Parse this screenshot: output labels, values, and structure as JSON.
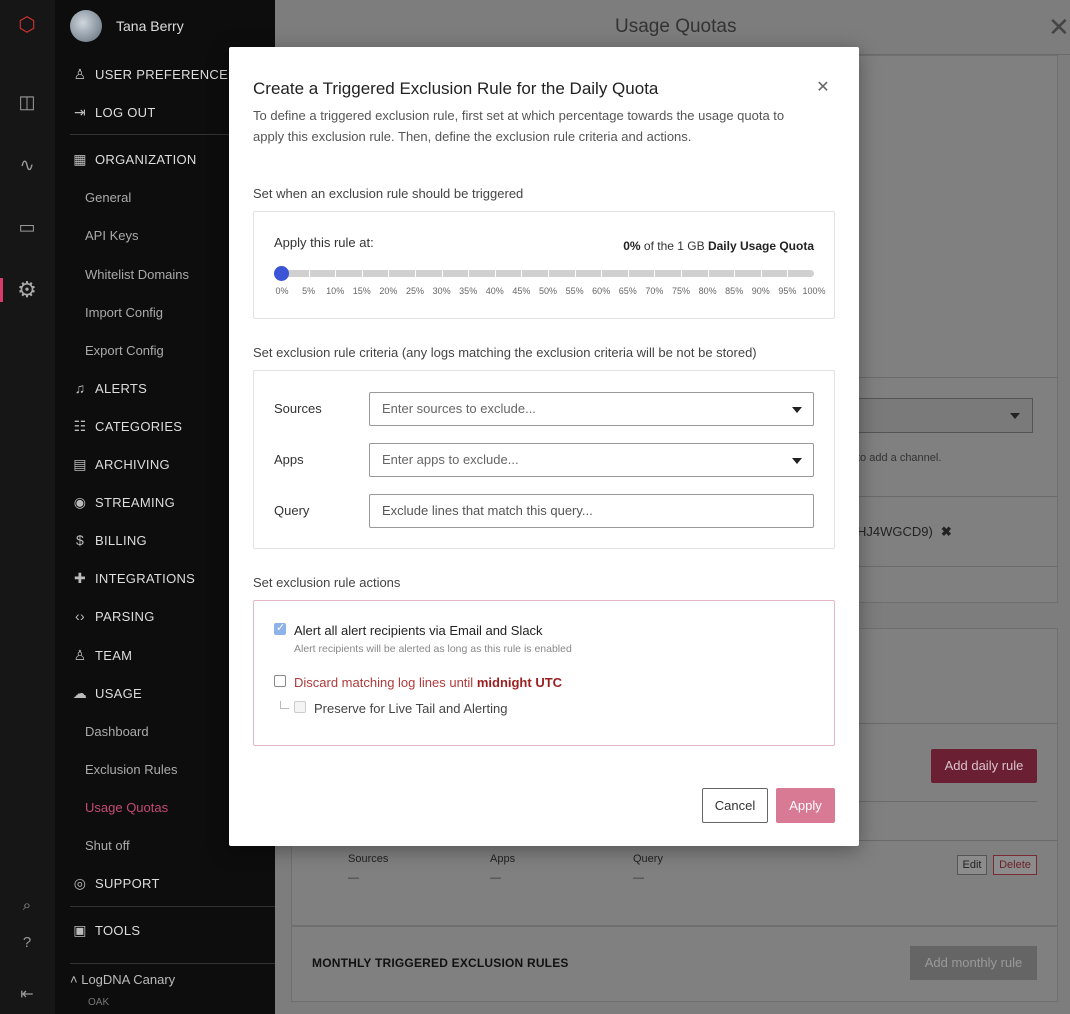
{
  "sidebar": {
    "user_name": "Tana Berry",
    "user_preferences": "USER PREFERENCES",
    "log_out": "LOG OUT",
    "organization": "ORGANIZATION",
    "org_items": [
      "General",
      "API Keys",
      "Whitelist Domains",
      "Import Config",
      "Export Config"
    ],
    "alerts": "ALERTS",
    "categories": "CATEGORIES",
    "archiving": "ARCHIVING",
    "streaming": "STREAMING",
    "billing": "BILLING",
    "integrations": "INTEGRATIONS",
    "parsing": "PARSING",
    "team": "TEAM",
    "usage": "USAGE",
    "usage_items": [
      "Dashboard",
      "Exclusion Rules",
      "Usage Quotas",
      "Shut off"
    ],
    "support": "SUPPORT",
    "tools": "TOOLS",
    "org_name": "LogDNA Canary",
    "org_sub": "OAK"
  },
  "panel": {
    "title": "Usage Quotas",
    "channel_hint": "to add a channel.",
    "channel_value": "HJ4WGCD9)",
    "add_daily_rule": "Add daily rule",
    "columns": [
      "Sources",
      "Apps",
      "Query"
    ],
    "dash": "—",
    "edit": "Edit",
    "delete": "Delete",
    "monthly_heading": "MONTHLY TRIGGERED EXCLUSION RULES",
    "add_monthly_rule": "Add monthly rule"
  },
  "modal": {
    "title": "Create a Triggered Exclusion Rule for the Daily Quota",
    "description": "To define a triggered exclusion rule, first set at which percentage towards the usage quota to apply this exclusion rule. Then, define the exclusion rule criteria and actions.",
    "trigger_section": "Set when an exclusion rule should be triggered",
    "apply_label": "Apply this rule at:",
    "quota_percent": "0%",
    "quota_mid": "of the 1 GB",
    "quota_name": "Daily Usage Quota",
    "slider_value": 0,
    "tick_labels": [
      "0%",
      "5%",
      "10%",
      "15%",
      "20%",
      "25%",
      "30%",
      "35%",
      "40%",
      "45%",
      "50%",
      "55%",
      "60%",
      "65%",
      "70%",
      "75%",
      "80%",
      "85%",
      "90%",
      "95%",
      "100%"
    ],
    "criteria_section": "Set exclusion rule criteria (any logs matching the exclusion criteria will be not be stored)",
    "sources_label": "Sources",
    "sources_placeholder": "Enter sources to exclude...",
    "apps_label": "Apps",
    "apps_placeholder": "Enter apps to exclude...",
    "query_label": "Query",
    "query_placeholder": "Exclude lines that match this query...",
    "actions_section": "Set exclusion rule actions",
    "alert_label": "Alert all alert recipients via Email and Slack",
    "alert_sub": "Alert recipients will be alerted as long as this rule is enabled",
    "discard_label": "Discard matching log lines until",
    "discard_bold": "midnight UTC",
    "preserve_label": "Preserve for Live Tail and Alerting",
    "cancel": "Cancel",
    "apply": "Apply"
  }
}
